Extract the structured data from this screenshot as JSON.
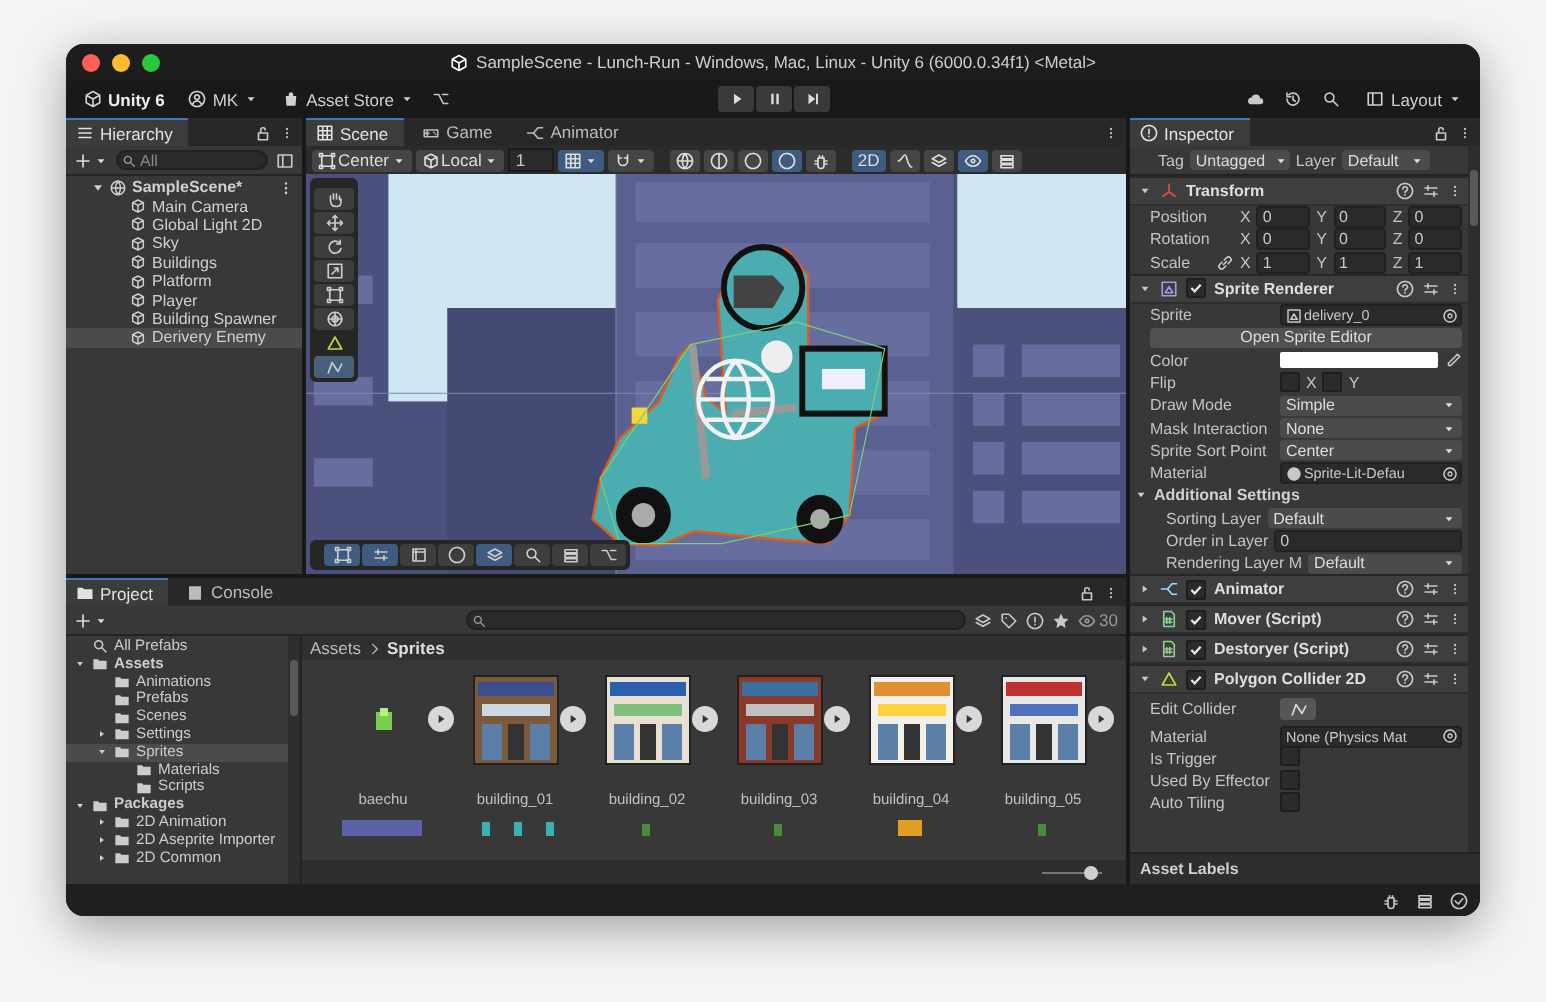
{
  "window": {
    "title": "SampleScene - Lunch-Run - Windows, Mac, Linux - Unity 6 (6000.0.34f1) <Metal>"
  },
  "toolbar": {
    "account": "Unity 6",
    "user": "MK",
    "store": "Asset Store",
    "layout": "Layout"
  },
  "hierarchy": {
    "tab": "Hierarchy",
    "search": {
      "placeholder": "All"
    },
    "tree": [
      {
        "label": "SampleScene*",
        "kind": "scene",
        "expanded": true,
        "selected": false,
        "children": [
          {
            "label": "Main Camera",
            "kind": "object",
            "selected": false
          },
          {
            "label": "Global Light 2D",
            "kind": "object",
            "selected": false
          },
          {
            "label": "Sky",
            "kind": "object",
            "selected": false
          },
          {
            "label": "Buildings",
            "kind": "object",
            "selected": false
          },
          {
            "label": "Platform",
            "kind": "object",
            "selected": false
          },
          {
            "label": "Player",
            "kind": "object",
            "selected": false
          },
          {
            "label": "Building Spawner",
            "kind": "object",
            "selected": false
          },
          {
            "label": "Derivery Enemy",
            "kind": "object",
            "selected": true
          }
        ]
      }
    ]
  },
  "scene": {
    "tabs": [
      {
        "label": "Scene",
        "kind": "scene",
        "selected": true
      },
      {
        "label": "Game",
        "kind": "game",
        "selected": false
      },
      {
        "label": "Animator",
        "kind": "animator",
        "selected": false
      }
    ],
    "pivot": "Center",
    "space": "Local",
    "snap": "1",
    "mode_2d": {
      "label": "2D",
      "selected": true
    },
    "tools": [
      {
        "kind": "hand",
        "selected": false
      },
      {
        "kind": "move",
        "selected": false
      },
      {
        "kind": "rotate",
        "selected": false
      },
      {
        "kind": "scale",
        "selected": false
      },
      {
        "kind": "rect",
        "selected": false
      },
      {
        "kind": "transform",
        "selected": false
      },
      {
        "kind": "collider",
        "selected": false
      },
      {
        "kind": "edit",
        "selected": true
      }
    ]
  },
  "project": {
    "tabs": [
      {
        "label": "Project",
        "kind": "project",
        "selected": true
      },
      {
        "label": "Console",
        "kind": "console",
        "selected": false
      }
    ],
    "hidden_count": "30",
    "tree": [
      {
        "label": "All Prefabs",
        "kind": "search",
        "selected": false
      },
      {
        "label": "Assets",
        "kind": "folder",
        "expanded": true,
        "selected": false,
        "children": [
          {
            "label": "Animations",
            "kind": "folder",
            "selected": false
          },
          {
            "label": "Prefabs",
            "kind": "folder",
            "selected": false
          },
          {
            "label": "Scenes",
            "kind": "folder",
            "selected": false
          },
          {
            "label": "Settings",
            "kind": "folder",
            "expanded": false,
            "selected": false
          },
          {
            "label": "Sprites",
            "kind": "folder",
            "expanded": true,
            "selected": true,
            "children": [
              {
                "label": "Materials",
                "kind": "folder",
                "selected": false
              },
              {
                "label": "Scripts",
                "kind": "folder",
                "selected": false
              }
            ]
          }
        ]
      },
      {
        "label": "Packages",
        "kind": "folder",
        "expanded": true,
        "selected": false,
        "children": [
          {
            "label": "2D Animation",
            "kind": "folder",
            "expanded": false,
            "selected": false
          },
          {
            "label": "2D Aseprite Importer",
            "kind": "folder",
            "expanded": false,
            "selected": false
          },
          {
            "label": "2D Common",
            "kind": "folder",
            "expanded": false,
            "selected": false
          }
        ]
      }
    ],
    "breadcrumb": [
      "Assets",
      "Sprites"
    ],
    "assets": [
      {
        "name": "baechu",
        "kind": "plant"
      },
      {
        "name": "building_01",
        "kind": "building"
      },
      {
        "name": "building_02",
        "kind": "building"
      },
      {
        "name": "building_03",
        "kind": "building"
      },
      {
        "name": "building_04",
        "kind": "building"
      },
      {
        "name": "building_05",
        "kind": "building"
      }
    ],
    "thumb_size": {
      "level": 0.92
    }
  },
  "inspector": {
    "tab": "Inspector",
    "tag_label": "Tag",
    "tag": "Untagged",
    "layer_label": "Layer",
    "layer": "Default",
    "components": [
      {
        "name": "Transform",
        "kind": "transform",
        "expanded": true,
        "fields": [
          {
            "kind": "vector",
            "label": "Position",
            "linked": false,
            "axes": [
              {
                "axis": "X",
                "value": "0"
              },
              {
                "axis": "Y",
                "value": "0"
              },
              {
                "axis": "Z",
                "value": "0"
              }
            ]
          },
          {
            "kind": "vector",
            "label": "Rotation",
            "linked": false,
            "axes": [
              {
                "axis": "X",
                "value": "0"
              },
              {
                "axis": "Y",
                "value": "0"
              },
              {
                "axis": "Z",
                "value": "0"
              }
            ]
          },
          {
            "kind": "vector",
            "label": "Scale",
            "linked": true,
            "axes": [
              {
                "axis": "X",
                "value": "1"
              },
              {
                "axis": "Y",
                "value": "1"
              },
              {
                "axis": "Z",
                "value": "1"
              }
            ]
          }
        ]
      },
      {
        "name": "Sprite Renderer",
        "kind": "sprite",
        "expanded": true,
        "enabled": true,
        "fields": [
          {
            "kind": "sprite_ref",
            "label": "Sprite",
            "value": "delivery_0"
          },
          {
            "kind": "button",
            "label": "Open Sprite Editor"
          },
          {
            "kind": "color",
            "label": "Color",
            "color": "#ffffff"
          },
          {
            "kind": "flip",
            "label": "Flip",
            "options": [
              {
                "label": "X",
                "checked": false
              },
              {
                "label": "Y",
                "checked": false
              }
            ]
          },
          {
            "kind": "dropdown",
            "label": "Draw Mode",
            "value": "Simple"
          },
          {
            "kind": "dropdown",
            "label": "Mask Interaction",
            "value": "None"
          },
          {
            "kind": "dropdown",
            "label": "Sprite Sort Point",
            "value": "Center"
          },
          {
            "kind": "material_ref",
            "label": "Material",
            "value": "Sprite-Lit-Defau"
          },
          {
            "kind": "section",
            "label": "Additional Settings",
            "expanded": true,
            "fields": [
              {
                "kind": "dropdown",
                "label": "Sorting Layer",
                "value": "Default"
              },
              {
                "kind": "number",
                "label": "Order in Layer",
                "value": "0"
              },
              {
                "kind": "dropdown",
                "label": "Rendering Layer M",
                "value": "Default"
              }
            ]
          }
        ]
      },
      {
        "name": "Animator",
        "kind": "animator",
        "expanded": false,
        "enabled": true
      },
      {
        "name": "Mover (Script)",
        "kind": "script",
        "expanded": false,
        "enabled": true
      },
      {
        "name": "Destoryer (Script)",
        "kind": "script",
        "expanded": false,
        "enabled": true
      },
      {
        "name": "Polygon Collider 2D",
        "kind": "collider",
        "expanded": true,
        "enabled": true,
        "fields": [
          {
            "kind": "tool",
            "label": "Edit Collider"
          },
          {
            "kind": "object",
            "label": "Material",
            "value": "None (Physics Mat"
          },
          {
            "kind": "checkbox",
            "label": "Is Trigger",
            "checked": false
          },
          {
            "kind": "checkbox",
            "label": "Used By Effector",
            "checked": false
          },
          {
            "kind": "checkbox",
            "label": "Auto Tiling",
            "checked": false
          }
        ]
      }
    ],
    "asset_labels": "Asset Labels"
  }
}
